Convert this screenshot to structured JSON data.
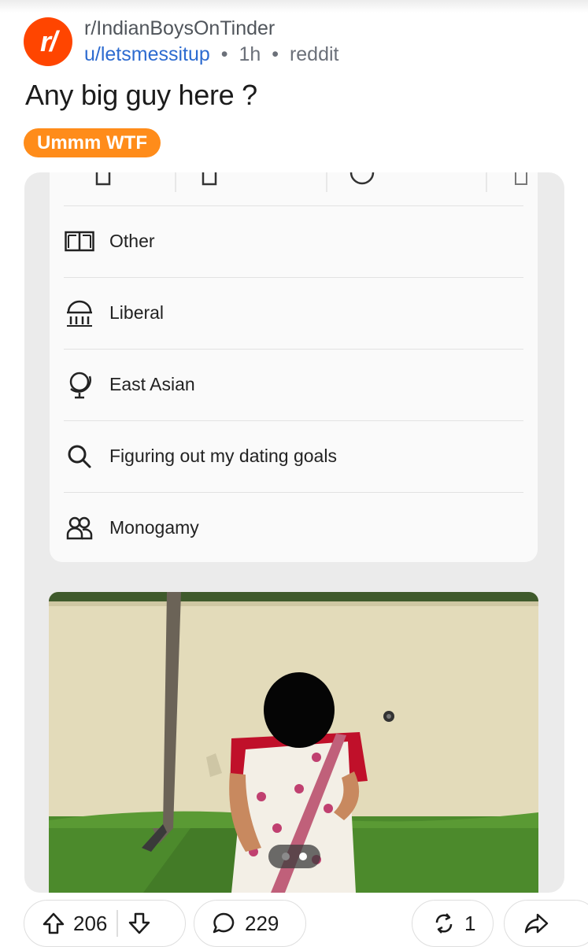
{
  "post": {
    "subreddit": "r/IndianBoysOnTinder",
    "avatar_glyph": "r/",
    "author": "u/letsmessitup",
    "age": "1h",
    "source": "reddit",
    "title": "Any big guy here ?",
    "flair": "Ummm WTF",
    "flair_color": "#ff8c1a"
  },
  "profile": {
    "rows": [
      {
        "icon": "book-icon",
        "label": "Other"
      },
      {
        "icon": "government-building-icon",
        "label": "Liberal"
      },
      {
        "icon": "globe-icon",
        "label": "East Asian"
      },
      {
        "icon": "search-icon",
        "label": "Figuring out my dating goals"
      },
      {
        "icon": "people-icon",
        "label": "Monogamy"
      }
    ]
  },
  "carousel": {
    "pages": 2,
    "active_page": 2
  },
  "actions": {
    "upvotes": "206",
    "comments": "229",
    "reposts": "1"
  }
}
